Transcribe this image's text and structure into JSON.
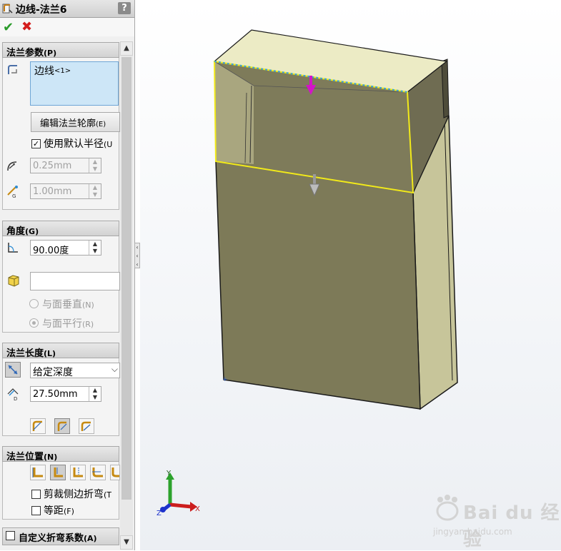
{
  "titlebar": {
    "title": "边线-法兰6",
    "help": "?"
  },
  "actions": {
    "ok": "✔",
    "cancel": "✖"
  },
  "groups": {
    "flange_params": {
      "header": "法兰参数",
      "header_mn": "(P)",
      "edge_item": "边线",
      "edge_item_sub": "<1>",
      "edit_profile_button": "编辑法兰轮廓",
      "edit_profile_mn": "(E)",
      "use_default_radius": {
        "label": "使用默认半径",
        "mn": "(U",
        "checked": true
      },
      "radius_value": "0.25mm",
      "gap_value": "1.00mm"
    },
    "angle": {
      "header": "角度",
      "header_mn": "(G)",
      "angle_value": "90.00度",
      "face_field_value": "",
      "radio_perpendicular": {
        "label": "与面垂直",
        "mn": "(N)"
      },
      "radio_parallel": {
        "label": "与面平行",
        "mn": "(R)"
      }
    },
    "flange_length": {
      "header": "法兰长度",
      "header_mn": "(L)",
      "end_condition": "给定深度",
      "length_value": "27.50mm"
    },
    "flange_position": {
      "header": "法兰位置",
      "header_mn": "(N)",
      "trim_side_bends": {
        "label": "剪裁侧边折弯",
        "mn": "(T",
        "checked": false
      },
      "offset": {
        "label": "等距",
        "mn": "(F)",
        "checked": false
      }
    },
    "custom_bend": {
      "label": "自定义折弯系数",
      "mn": "(A)",
      "checked": false
    }
  },
  "triad": {
    "x": "X",
    "y": "Y",
    "z": "Z"
  },
  "watermark": {
    "brand": "Bai du 经验",
    "url": "jingyan.baidu.com"
  },
  "colors": {
    "model_face": "#7d7a58",
    "model_top": "#ecebc5",
    "selection": "#f2ea1a",
    "drag_arrow": "#d414c7"
  }
}
